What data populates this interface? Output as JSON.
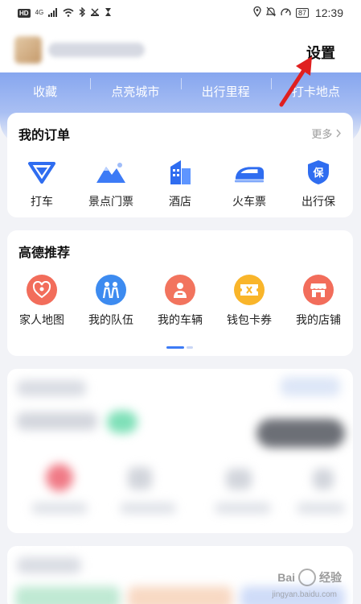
{
  "status_bar": {
    "left_icons": [
      "hd-icon",
      "signal-icon",
      "wifi-icon",
      "bluetooth-icon",
      "nfc-icon",
      "hourglass-icon"
    ],
    "hd_label": "HD",
    "network_label": "4G",
    "right_icons": [
      "location-icon",
      "mute-icon",
      "speed-icon",
      "battery-icon"
    ],
    "battery_level": "87",
    "time": "12:39"
  },
  "header": {
    "settings_label": "设置"
  },
  "quick_tabs": [
    "收藏",
    "点亮城市",
    "出行里程",
    "打卡地点"
  ],
  "orders": {
    "title": "我的订单",
    "more_label": "更多",
    "items": [
      {
        "label": "打车",
        "icon": "taxi-icon"
      },
      {
        "label": "景点门票",
        "icon": "mountain-icon"
      },
      {
        "label": "酒店",
        "icon": "hotel-icon"
      },
      {
        "label": "火车票",
        "icon": "train-icon"
      },
      {
        "label": "出行保",
        "icon": "shield-icon"
      }
    ]
  },
  "recommend": {
    "title": "高德推荐",
    "items": [
      {
        "label": "家人地图",
        "icon": "family-map-icon"
      },
      {
        "label": "我的队伍",
        "icon": "team-icon"
      },
      {
        "label": "我的车辆",
        "icon": "vehicle-icon"
      },
      {
        "label": "钱包卡券",
        "icon": "wallet-icon"
      },
      {
        "label": "我的店铺",
        "icon": "shop-icon"
      }
    ]
  },
  "colors": {
    "accent_blue": "#3d7bf6",
    "band_blue": "#86a6ef",
    "red_arrow": "#e02020"
  },
  "watermark": {
    "brand": "Bai",
    "brand_suffix": "经验",
    "sub": "jingyan.baidu.com"
  }
}
